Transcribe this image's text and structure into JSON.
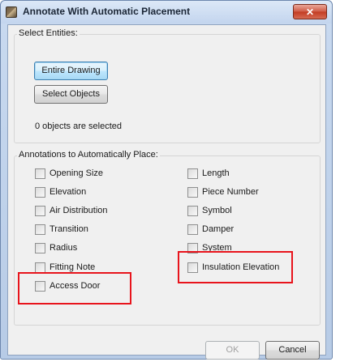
{
  "window": {
    "title": "Annotate With Automatic Placement",
    "close_label": "✕"
  },
  "select_entities": {
    "label": "Select Entities:",
    "entire_drawing_label": "Entire Drawing",
    "select_objects_label": "Select Objects",
    "status_text": "0 objects are selected"
  },
  "annotations": {
    "label": "Annotations to Automatically Place:",
    "left_column": [
      {
        "label": "Opening Size",
        "checked": false
      },
      {
        "label": "Elevation",
        "checked": false
      },
      {
        "label": "Air Distribution",
        "checked": false
      },
      {
        "label": "Transition",
        "checked": false
      },
      {
        "label": "Radius",
        "checked": false
      },
      {
        "label": "Fitting Note",
        "checked": false
      },
      {
        "label": "Access Door",
        "checked": false
      }
    ],
    "right_column": [
      {
        "label": "Length",
        "checked": false
      },
      {
        "label": "Piece Number",
        "checked": false
      },
      {
        "label": "Symbol",
        "checked": false
      },
      {
        "label": "Damper",
        "checked": false
      },
      {
        "label": "System",
        "checked": false
      },
      {
        "label": "Insulation Elevation",
        "checked": false
      }
    ]
  },
  "footer": {
    "ok_label": "OK",
    "cancel_label": "Cancel"
  },
  "colors": {
    "highlight": "#e8141c",
    "close_button": "#c23b22",
    "title_bar": "#c3d5ee"
  }
}
